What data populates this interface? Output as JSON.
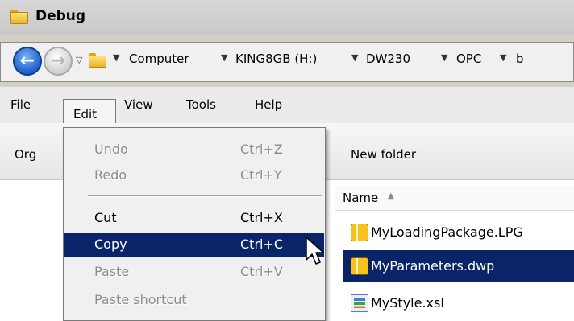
{
  "window": {
    "title": "Debug"
  },
  "address": {
    "crumbs": [
      "Computer",
      "KING8GB (H:)",
      "DW230",
      "OPC",
      "b"
    ]
  },
  "menubar": {
    "items": [
      "File",
      "Edit",
      "View",
      "Tools",
      "Help"
    ]
  },
  "toolbar": {
    "organize_label": "Org",
    "new_folder_label": "New folder"
  },
  "edit_menu": {
    "items": [
      {
        "label": "Undo",
        "shortcut": "Ctrl+Z",
        "enabled": false
      },
      {
        "label": "Redo",
        "shortcut": "Ctrl+Y",
        "enabled": false
      },
      {
        "label": "Cut",
        "shortcut": "Ctrl+X",
        "enabled": true
      },
      {
        "label": "Copy",
        "shortcut": "Ctrl+C",
        "enabled": true,
        "highlighted": true
      },
      {
        "label": "Paste",
        "shortcut": "Ctrl+V",
        "enabled": false
      },
      {
        "label": "Paste shortcut",
        "shortcut": "",
        "enabled": false
      }
    ]
  },
  "file_list": {
    "column_name": "Name",
    "files": [
      {
        "name": "MyLoadingPackage.LPG",
        "icon": "package-icon",
        "selected": false
      },
      {
        "name": "MyParameters.dwp",
        "icon": "package-icon",
        "selected": true
      },
      {
        "name": "MyStyle.xsl",
        "icon": "xsl-file-icon",
        "selected": false
      }
    ]
  },
  "colors": {
    "selection": "#0a246a",
    "menu_background": "#f0f0f0",
    "disabled_text": "#8d8d8d"
  }
}
